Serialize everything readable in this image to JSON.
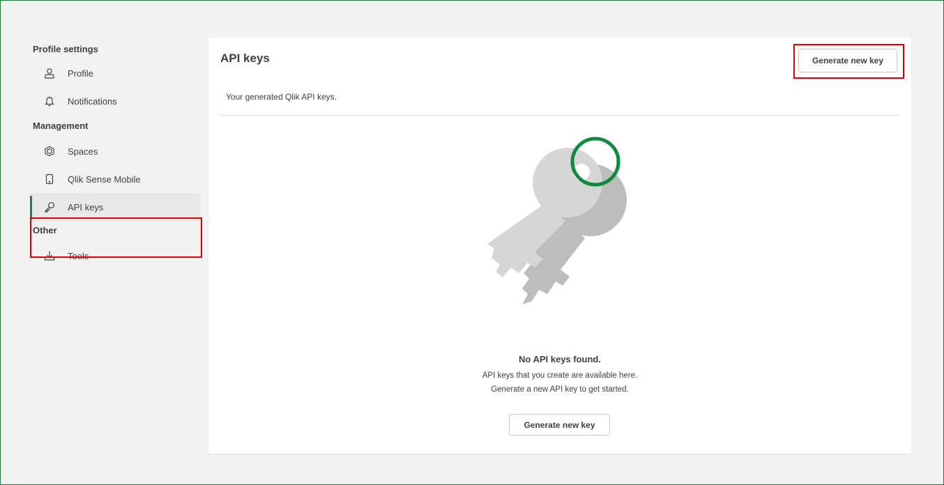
{
  "sidebar": {
    "sections": [
      {
        "title": "Profile settings",
        "items": [
          {
            "label": "Profile",
            "icon": "person-icon"
          },
          {
            "label": "Notifications",
            "icon": "bell-icon"
          }
        ]
      },
      {
        "title": "Management",
        "items": [
          {
            "label": "Spaces",
            "icon": "spaces-icon"
          },
          {
            "label": "Qlik Sense Mobile",
            "icon": "mobile-icon"
          },
          {
            "label": "API keys",
            "icon": "key-icon",
            "active": true
          }
        ]
      },
      {
        "title": "Other",
        "items": [
          {
            "label": "Tools",
            "icon": "download-icon"
          }
        ]
      }
    ]
  },
  "main": {
    "title": "API keys",
    "subtitle": "Your generated Qlik API keys.",
    "generate_button_label": "Generate new key",
    "empty_state": {
      "title": "No API keys found.",
      "line1": "API keys that you create are available here.",
      "line2": "Generate a new API key to get started.",
      "button_label": "Generate new key",
      "illustration_icon": "keys-illustration-icon"
    }
  },
  "colors": {
    "accent_green": "#108a3c",
    "frame_border": "#1e7a3c",
    "highlight_red": "#e10000",
    "key_light_gray": "#d6d6d6",
    "key_dark_gray": "#bdbdbd"
  }
}
